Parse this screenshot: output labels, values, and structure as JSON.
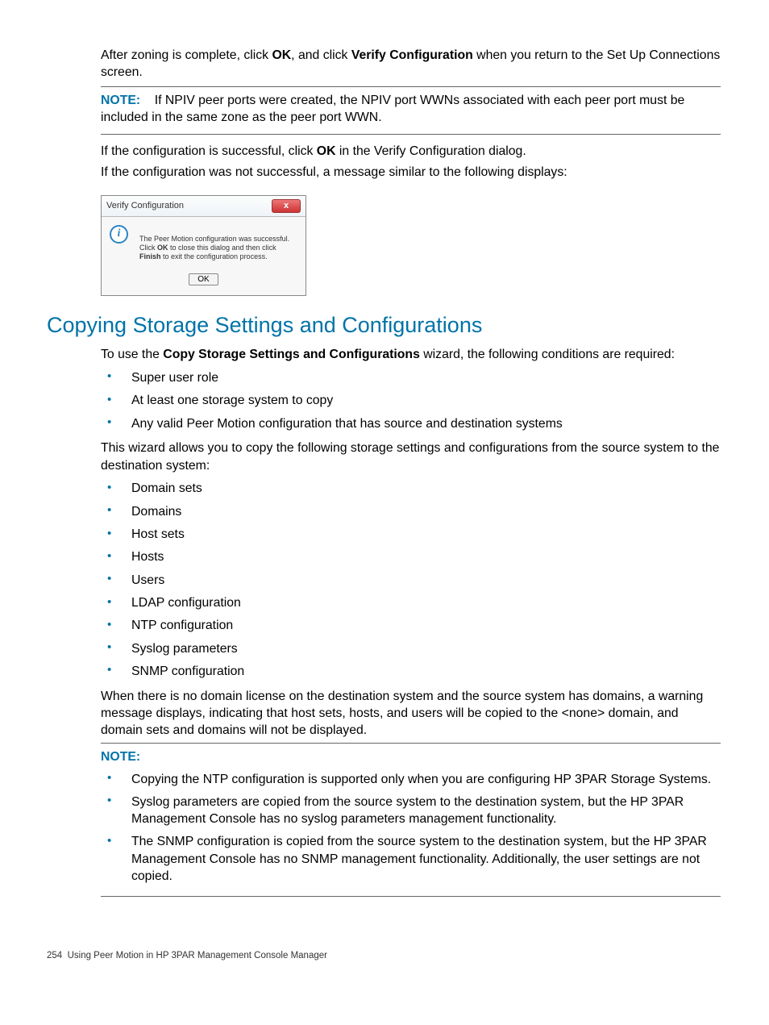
{
  "para1_a": "After zoning is complete, click ",
  "para1_b": "OK",
  "para1_c": ", and click ",
  "para1_d": "Verify Configuration",
  "para1_e": " when you return to the Set Up Connections screen.",
  "note1_label": "NOTE:",
  "note1_text": "If NPIV peer ports were created, the NPIV port WWNs associated with each peer port must be included in the same zone as the peer port WWN.",
  "para2_a": "If the configuration is successful, click ",
  "para2_b": "OK",
  "para2_c": " in the Verify Configuration dialog.",
  "para3": "If the configuration was not successful, a message similar to the following displays:",
  "dialog_title": "Verify Configuration",
  "dialog_close": "x",
  "dialog_info": "i",
  "dialog_msg_a": "The Peer Motion configuration was successful. Click ",
  "dialog_msg_b": "OK",
  "dialog_msg_c": " to close this dialog and then click ",
  "dialog_msg_d": "Finish",
  "dialog_msg_e": " to exit the configuration process.",
  "dialog_ok": "OK",
  "heading": "Copying Storage Settings and Configurations",
  "para4_a": "To use the ",
  "para4_b": "Copy Storage Settings and Configurations",
  "para4_c": " wizard, the following conditions are required:",
  "list1": [
    "Super user role",
    "At least one storage system to copy",
    "Any valid Peer Motion configuration that has source and destination systems"
  ],
  "para5": "This wizard allows you to copy the following storage settings and configurations from the source system to the destination system:",
  "list2": [
    "Domain sets",
    "Domains",
    "Host sets",
    "Hosts",
    "Users",
    "LDAP configuration",
    "NTP configuration",
    "Syslog parameters",
    "SNMP configuration"
  ],
  "para6": "When there is no domain license on the destination system and the source system has domains, a warning message displays, indicating that host sets, hosts, and users will be copied to the <none> domain, and domain sets and domains will not be displayed.",
  "note2_label": "NOTE:",
  "note2_items": [
    "Copying the NTP configuration is supported only when you are configuring HP 3PAR Storage Systems.",
    "Syslog parameters are copied from the source system to the destination system, but the HP 3PAR Management Console has no syslog parameters management functionality.",
    "The SNMP configuration is copied from the source system to the destination system, but the HP 3PAR Management Console has no SNMP management functionality. Additionally, the user settings are not copied."
  ],
  "footer_page": "254",
  "footer_title": "Using Peer Motion in HP 3PAR Management Console Manager"
}
